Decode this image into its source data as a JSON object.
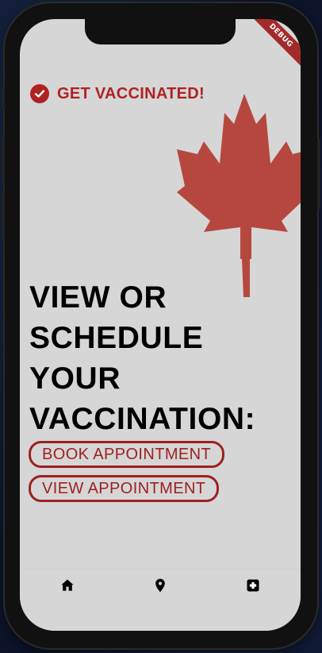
{
  "debug_banner": "DEBUG",
  "header": {
    "icon": "check-circle-icon",
    "title": "GET VACCINATED!"
  },
  "decoration": {
    "icon": "maple-leaf-icon",
    "color": "#b6473f"
  },
  "headline": "VIEW OR\nSCHEDULE\nYOUR\nVACCINATION:",
  "buttons": {
    "book_label": "BOOK APPOINTMENT",
    "view_label": "VIEW APPOINTMENT"
  },
  "bottom_nav": [
    {
      "icon": "home-icon"
    },
    {
      "icon": "location-pin-icon"
    },
    {
      "icon": "medical-cross-icon"
    }
  ],
  "colors": {
    "accent": "#b02222",
    "background": "#d6d6d6",
    "text": "#000000"
  }
}
